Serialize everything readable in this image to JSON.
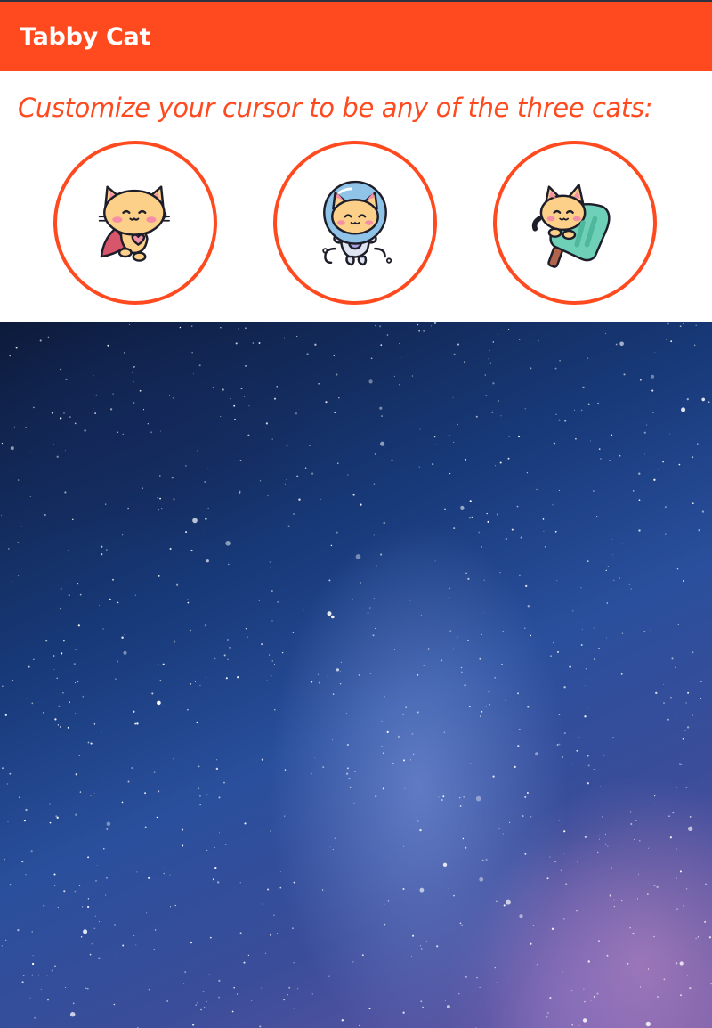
{
  "header": {
    "title": "Tabby Cat"
  },
  "subtitle": "Customize your cursor to be any of the three cats:",
  "cats": [
    {
      "name": "superhero cat",
      "icon": "flying-cat-icon"
    },
    {
      "name": "astronaut cat",
      "icon": "astronaut-cat-icon"
    },
    {
      "name": "popsicle cat",
      "icon": "popsicle-cat-icon"
    }
  ],
  "colors": {
    "accent": "#ff4a1f",
    "cat_fur": "#fdd08a",
    "cat_outline": "#1e1e2a",
    "blush": "#f58fa6",
    "helmet": "#8fc4e8",
    "popsicle": "#6fd0b8",
    "stick": "#b0644a"
  },
  "background": {
    "description_icon": "starry-sky-image"
  }
}
